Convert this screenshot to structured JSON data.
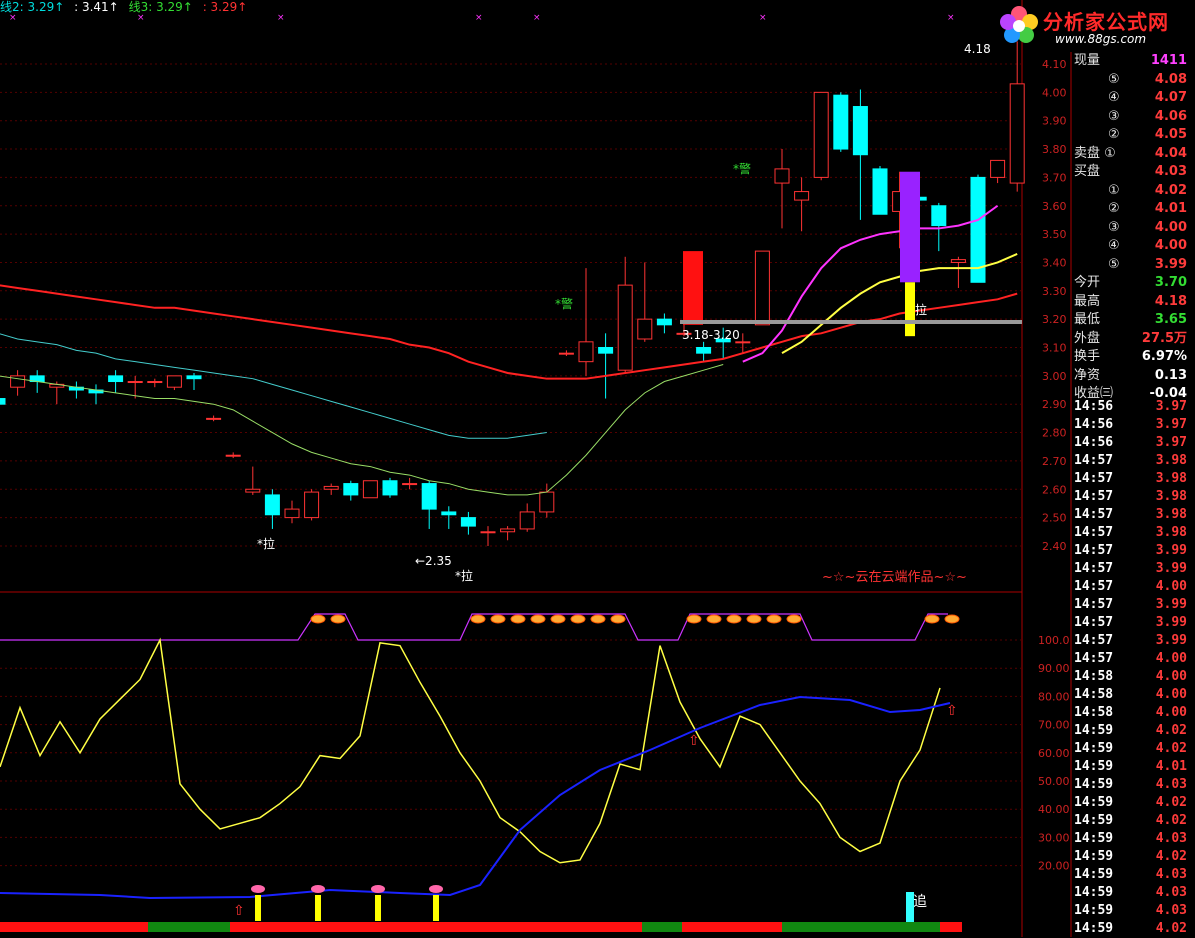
{
  "legend": [
    {
      "label": "线2: 3.29↑",
      "color": "#00dddd"
    },
    {
      "label": ": 3.41↑",
      "color": "#ffffff"
    },
    {
      "label": "线3: 3.29↑",
      "color": "#33dd33"
    },
    {
      "label": ": 3.29↑",
      "color": "#ff3333"
    }
  ],
  "logo": {
    "text": "分析家公式网",
    "url": "www.88gs.com"
  },
  "credit": "~☆~云在云端作品~☆~",
  "annotations": {
    "high": "4.18",
    "low": "2.35",
    "range": "3.18-3.20",
    "la1": "*拉",
    "la2": "*拉",
    "la3": "拉",
    "jing1": "*警",
    "jing2": "*警",
    "zhui": "追"
  },
  "axis_main": {
    "min": 2.4,
    "max": 4.1,
    "step": 0.1,
    "labels": [
      "4.10",
      "4.00",
      "3.90",
      "3.80",
      "3.70",
      "3.60",
      "3.50",
      "3.40",
      "3.30",
      "3.20",
      "3.10",
      "3.00",
      "2.90",
      "2.80",
      "2.70",
      "2.60",
      "2.50",
      "2.40"
    ]
  },
  "axis_sub": {
    "labels": [
      "100.0",
      "90.00",
      "80.00",
      "70.00",
      "60.00",
      "50.00",
      "40.00",
      "30.00",
      "20.00"
    ]
  },
  "colors": {
    "up": "#ff3333",
    "down": "#00ffff",
    "ma_red": "#ff2222",
    "ma_yellow": "#ffff44",
    "ma_mag": "#ff33ff",
    "ma_cyan": "#44cccc",
    "ma_green": "#99dd66",
    "osc_yellow": "#ffff44",
    "osc_blue": "#1a22ff"
  },
  "chart_data": {
    "type": "candlestick",
    "candles": [
      [
        2.92,
        2.94,
        2.88,
        2.9
      ],
      [
        2.96,
        3.02,
        2.93,
        3.0
      ],
      [
        3.0,
        3.02,
        2.94,
        2.98
      ],
      [
        2.96,
        2.98,
        2.9,
        2.97
      ],
      [
        2.96,
        2.98,
        2.92,
        2.95
      ],
      [
        2.95,
        2.97,
        2.9,
        2.94
      ],
      [
        3.0,
        3.02,
        2.94,
        2.98
      ],
      [
        2.98,
        3.0,
        2.92,
        2.98
      ],
      [
        2.98,
        2.99,
        2.96,
        2.98
      ],
      [
        2.96,
        3.0,
        2.95,
        3.0
      ],
      [
        3.0,
        3.01,
        2.95,
        2.99
      ],
      [
        2.85,
        2.86,
        2.84,
        2.85
      ],
      [
        2.72,
        2.73,
        2.71,
        2.72
      ],
      [
        2.59,
        2.68,
        2.58,
        2.6
      ],
      [
        2.58,
        2.6,
        2.46,
        2.51
      ],
      [
        2.5,
        2.56,
        2.48,
        2.53
      ],
      [
        2.5,
        2.6,
        2.49,
        2.59
      ],
      [
        2.6,
        2.62,
        2.58,
        2.61
      ],
      [
        2.62,
        2.63,
        2.56,
        2.58
      ],
      [
        2.57,
        2.63,
        2.57,
        2.63
      ],
      [
        2.63,
        2.64,
        2.57,
        2.58
      ],
      [
        2.62,
        2.64,
        2.6,
        2.62
      ],
      [
        2.62,
        2.63,
        2.46,
        2.53
      ],
      [
        2.52,
        2.54,
        2.46,
        2.51
      ],
      [
        2.5,
        2.52,
        2.44,
        2.47
      ],
      [
        2.45,
        2.47,
        2.4,
        2.45
      ],
      [
        2.45,
        2.47,
        2.42,
        2.46
      ],
      [
        2.46,
        2.55,
        2.45,
        2.52
      ],
      [
        2.52,
        2.62,
        2.5,
        2.59
      ],
      [
        3.08,
        3.09,
        3.07,
        3.08
      ],
      [
        3.05,
        3.38,
        3.0,
        3.12
      ],
      [
        3.1,
        3.15,
        2.92,
        3.08
      ],
      [
        3.02,
        3.42,
        3.01,
        3.32
      ],
      [
        3.13,
        3.4,
        3.12,
        3.2
      ],
      [
        3.2,
        3.22,
        3.15,
        3.18
      ],
      [
        3.15,
        3.27,
        3.14,
        3.15
      ],
      [
        3.1,
        3.12,
        3.05,
        3.08
      ],
      [
        3.13,
        3.17,
        3.06,
        3.12
      ],
      [
        3.12,
        3.15,
        3.08,
        3.12
      ],
      [
        3.18,
        3.44,
        3.18,
        3.44
      ],
      [
        3.68,
        3.8,
        3.52,
        3.73
      ],
      [
        3.62,
        3.7,
        3.51,
        3.65
      ],
      [
        3.7,
        4.0,
        3.69,
        4.0
      ],
      [
        3.99,
        4.0,
        3.79,
        3.8
      ],
      [
        3.95,
        4.01,
        3.55,
        3.78
      ],
      [
        3.73,
        3.74,
        3.57,
        3.57
      ],
      [
        3.58,
        3.72,
        3.45,
        3.65
      ],
      [
        3.63,
        3.67,
        3.56,
        3.62
      ],
      [
        3.6,
        3.61,
        3.44,
        3.53
      ],
      [
        3.4,
        3.42,
        3.31,
        3.41
      ],
      [
        3.7,
        3.71,
        3.33,
        3.33
      ],
      [
        3.7,
        3.75,
        3.68,
        3.76
      ],
      [
        3.68,
        4.18,
        3.65,
        4.03
      ]
    ],
    "ma_red": [
      3.32,
      3.31,
      3.3,
      3.29,
      3.28,
      3.27,
      3.26,
      3.25,
      3.24,
      3.24,
      3.23,
      3.22,
      3.21,
      3.2,
      3.19,
      3.18,
      3.17,
      3.16,
      3.15,
      3.14,
      3.13,
      3.11,
      3.1,
      3.08,
      3.05,
      3.03,
      3.01,
      3.0,
      2.99,
      2.99,
      2.99,
      3.0,
      3.01,
      3.02,
      3.03,
      3.04,
      3.05,
      3.06,
      3.08,
      3.1,
      3.12,
      3.14,
      3.15,
      3.17,
      3.19,
      3.2,
      3.22,
      3.23,
      3.24,
      3.25,
      3.26,
      3.27,
      3.29
    ],
    "ma_cyan": [
      3.15,
      3.13,
      3.12,
      3.11,
      3.09,
      3.08,
      3.06,
      3.05,
      3.04,
      3.03,
      3.02,
      3.01,
      3.0,
      2.99,
      2.97,
      2.95,
      2.93,
      2.91,
      2.89,
      2.87,
      2.85,
      2.83,
      2.81,
      2.79,
      2.78,
      2.78,
      2.78,
      2.79,
      2.8
    ],
    "ma_green": [
      3.0,
      2.99,
      2.98,
      2.97,
      2.96,
      2.95,
      2.94,
      2.93,
      2.92,
      2.92,
      2.91,
      2.9,
      2.88,
      2.84,
      2.8,
      2.76,
      2.73,
      2.71,
      2.69,
      2.68,
      2.66,
      2.65,
      2.63,
      2.62,
      2.6,
      2.59,
      2.58,
      2.58,
      2.59,
      2.65,
      2.72,
      2.8,
      2.88,
      2.94,
      2.98,
      3.0,
      3.02,
      3.04
    ],
    "ma_yellow": [
      3.08,
      3.12,
      3.18,
      3.24,
      3.29,
      3.33,
      3.35,
      3.37,
      3.38,
      3.38,
      3.38,
      3.4,
      3.43
    ],
    "ma_mag": [
      3.05,
      3.08,
      3.16,
      3.28,
      3.38,
      3.45,
      3.48,
      3.5,
      3.51,
      3.52,
      3.52,
      3.53,
      3.55,
      3.6
    ],
    "osc_yellow": [
      55,
      76,
      59,
      71,
      60,
      72,
      79,
      86,
      100,
      49,
      40,
      33,
      35,
      37,
      42,
      48,
      59,
      58,
      66,
      99,
      98,
      85,
      73,
      60,
      50,
      37,
      32,
      25,
      21,
      22,
      35,
      56,
      54,
      98,
      78,
      65,
      55,
      73,
      70,
      60,
      50,
      42,
      30,
      25,
      28,
      50,
      61,
      83
    ]
  }
}
